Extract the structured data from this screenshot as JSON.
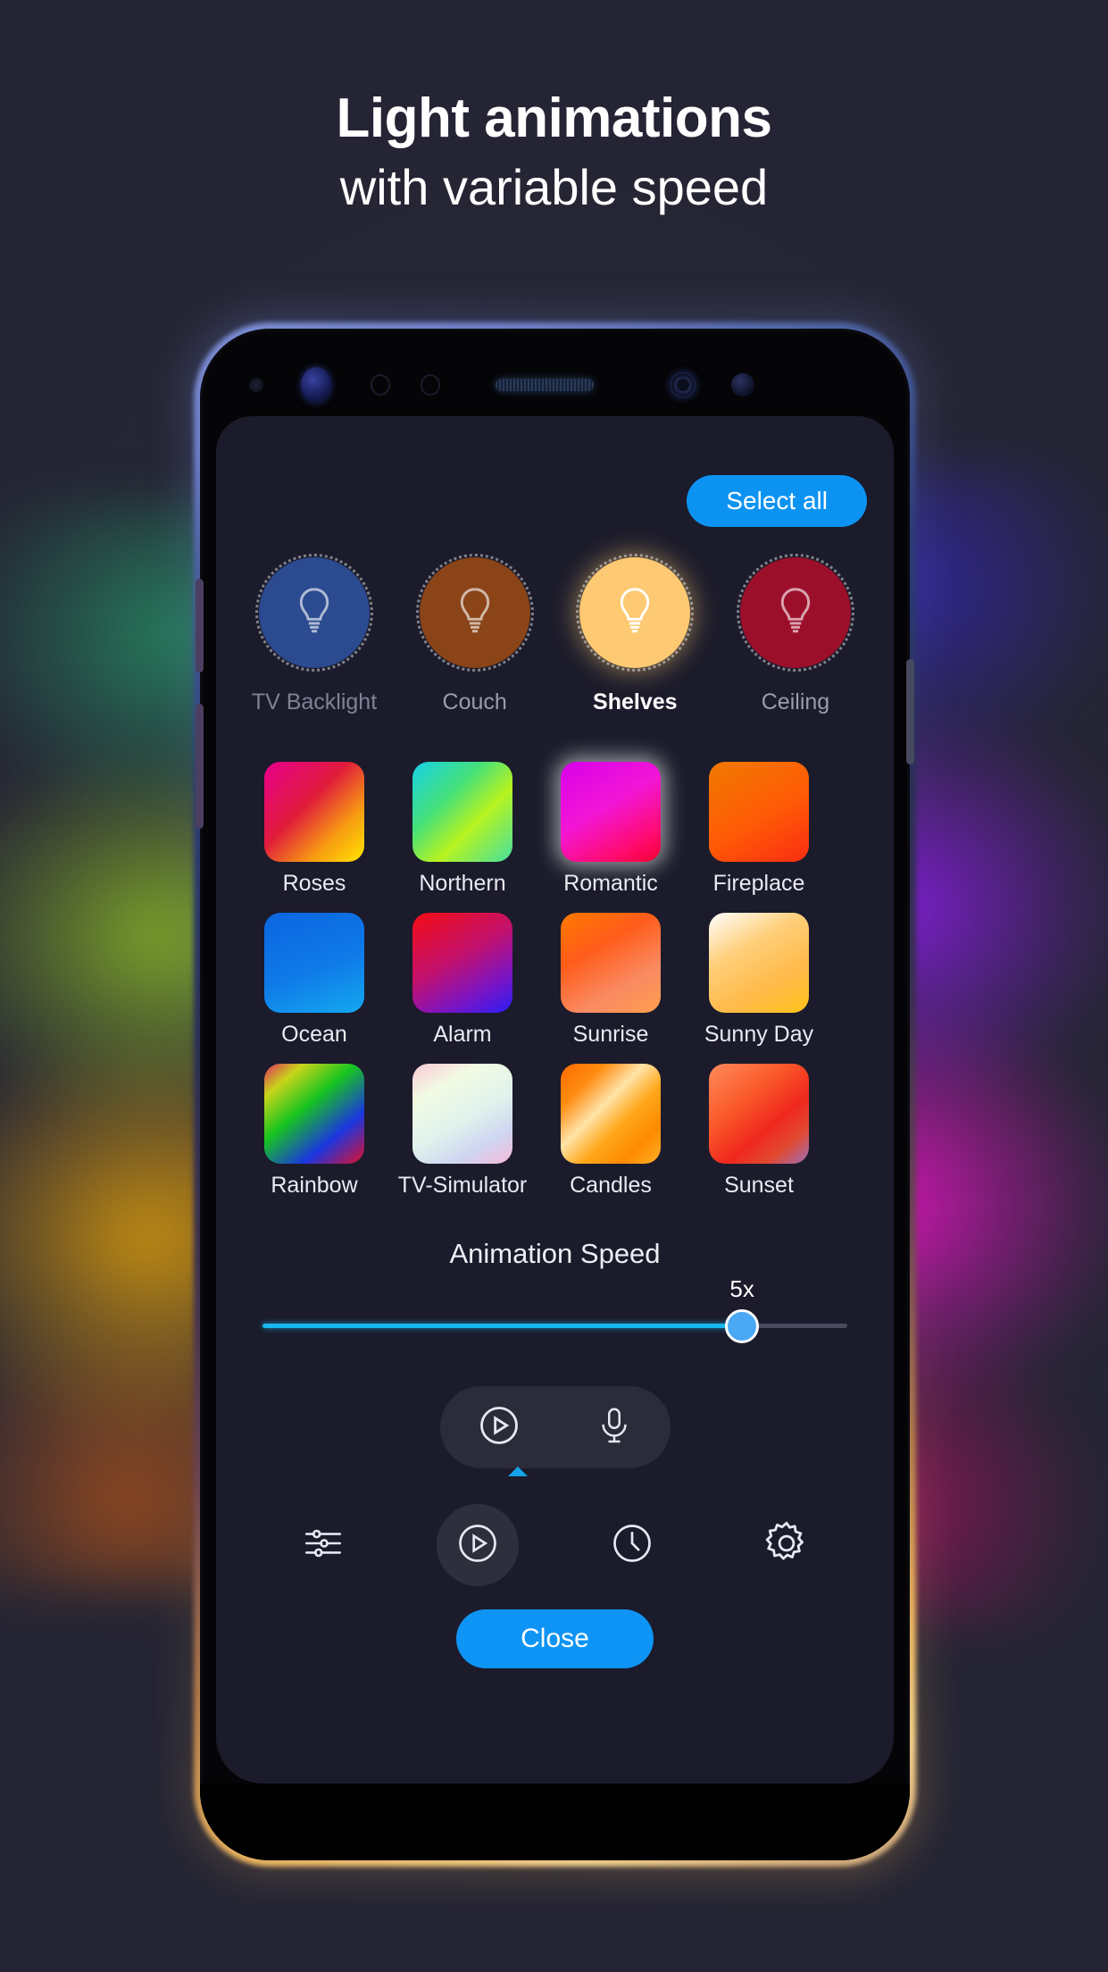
{
  "headline": {
    "line1": "Light animations",
    "line2": "with variable speed"
  },
  "colors": {
    "accent_blue": "#0c93f2",
    "slider_fill": "#19b7ef",
    "slider_thumb": "#4aa8f5",
    "screen_bg": "#1b1b2b",
    "page_bg": "#262636"
  },
  "app": {
    "toolbar": {
      "select_all_label": "Select all"
    },
    "lights": [
      {
        "name": "TV Backlight",
        "color": "#2b4a8f",
        "selected": false,
        "label_color": "#7e8295"
      },
      {
        "name": "Couch",
        "color": "#8a4418",
        "selected": false,
        "label_color": "#9a9cab"
      },
      {
        "name": "Shelves",
        "color": "#fdc972",
        "selected": true,
        "label_color": "#ffffff"
      },
      {
        "name": "Ceiling",
        "color": "#9c0f2a",
        "selected": false,
        "label_color": "#9a9cab"
      }
    ],
    "scenes": [
      {
        "name": "Roses",
        "selected": false,
        "gradient": "linear-gradient(135deg,#e8008c 0%,#e01b3c 42%,#f79a12 72%,#ffe600 100%)"
      },
      {
        "name": "Northern",
        "selected": false,
        "gradient": "linear-gradient(135deg,#16d2e6 0%,#45e07a 35%,#b6f320 62%,#46e0a0 100%)"
      },
      {
        "name": "Romantic",
        "selected": true,
        "gradient": "linear-gradient(150deg,#d900e8 0%,#f216d6 45%,#ff0b6e 80%,#f50032 100%)"
      },
      {
        "name": "Fireplace",
        "selected": false,
        "gradient": "linear-gradient(150deg,#f07a00 0%,#ff5a06 55%,#fa2d12 100%)"
      },
      {
        "name": "Ocean",
        "selected": false,
        "gradient": "linear-gradient(160deg,#0b66e0 0%,#0f7ae8 55%,#14a8f0 100%)"
      },
      {
        "name": "Alarm",
        "selected": false,
        "gradient": "linear-gradient(150deg,#f40d12 0%,#c2116e 45%,#7a14c4 75%,#2a1ef5 100%)"
      },
      {
        "name": "Sunrise",
        "selected": false,
        "gradient": "linear-gradient(150deg,#ff7a00 0%,#ff5c1a 35%,#fa8a62 70%,#ff9f4e 100%)"
      },
      {
        "name": "Sunny Day",
        "selected": false,
        "gradient": "linear-gradient(150deg,#ffffff 0%,#ffcf7a 35%,#ffb947 70%,#ffc21a 100%)"
      },
      {
        "name": "Rainbow",
        "selected": false,
        "gradient": "linear-gradient(140deg,#e02b5e 0%,#c8d41a 18%,#17c41f 42%,#1b36e0 72%,#e0102a 100%)"
      },
      {
        "name": "TV-Simulator",
        "selected": false,
        "gradient": "linear-gradient(150deg,#f9c9d4 0%,#f2fbe4 25%,#dff2ec 55%,#cfd6f2 78%,#f7b8d8 100%)"
      },
      {
        "name": "Candles",
        "selected": false,
        "gradient": "linear-gradient(135deg,#ff6a00 0%,#ff8c10 22%,#ffe3a8 42%,#ffa81c 60%,#ff8a00 80%,#ffb027 100%)"
      },
      {
        "name": "Sunset",
        "selected": false,
        "gradient": "linear-gradient(140deg,#ff8a5c 0%,#fa5a2a 35%,#f0281e 62%,#e24830 80%,#9d6fb8 100%)"
      }
    ],
    "speed": {
      "title": "Animation Speed",
      "value_label": "5x",
      "percent": 82
    },
    "pill": {
      "play_icon": "play-circle-icon",
      "mic_icon": "microphone-icon"
    },
    "nav": [
      {
        "icon": "sliders-icon",
        "name": "effects",
        "active": false
      },
      {
        "icon": "play-circle-icon",
        "name": "play",
        "active": true
      },
      {
        "icon": "clock-icon",
        "name": "timer",
        "active": false
      },
      {
        "icon": "gear-icon",
        "name": "settings",
        "active": false
      }
    ],
    "close_label": "Close"
  }
}
